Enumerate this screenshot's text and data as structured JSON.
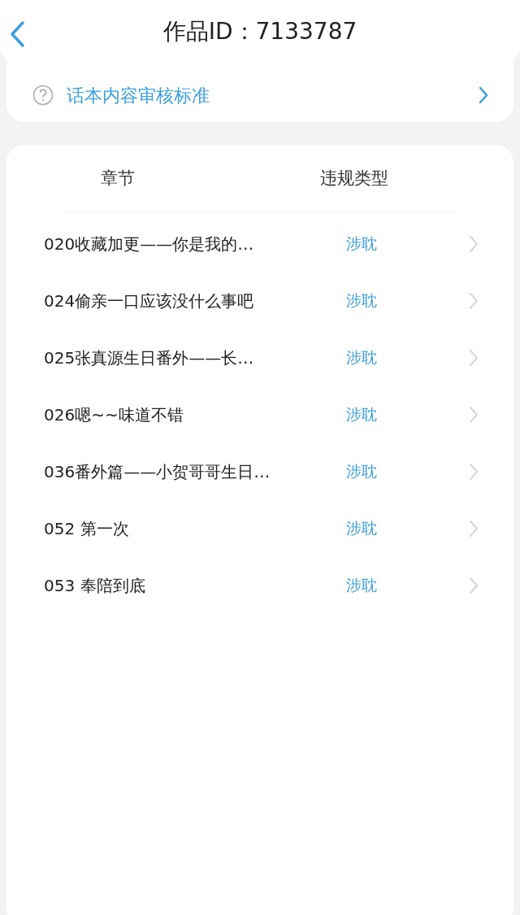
{
  "header": {
    "title": "作品ID：7133787"
  },
  "guideline_link": {
    "label": "话本内容审核标准"
  },
  "table": {
    "columns": [
      "章节",
      "违规类型"
    ],
    "rows": [
      {
        "chapter": "020收藏加更——你是我的…",
        "violation": "涉耽"
      },
      {
        "chapter": "024偷亲一口应该没什么事吧",
        "violation": "涉耽"
      },
      {
        "chapter": "025张真源生日番外——长…",
        "violation": "涉耽"
      },
      {
        "chapter": "026嗯~~味道不错",
        "violation": "涉耽"
      },
      {
        "chapter": "036番外篇——小贺哥哥生日…",
        "violation": "涉耽"
      },
      {
        "chapter": "052 第一次",
        "violation": "涉耽"
      },
      {
        "chapter": "053 奉陪到底",
        "violation": "涉耽"
      }
    ]
  }
}
